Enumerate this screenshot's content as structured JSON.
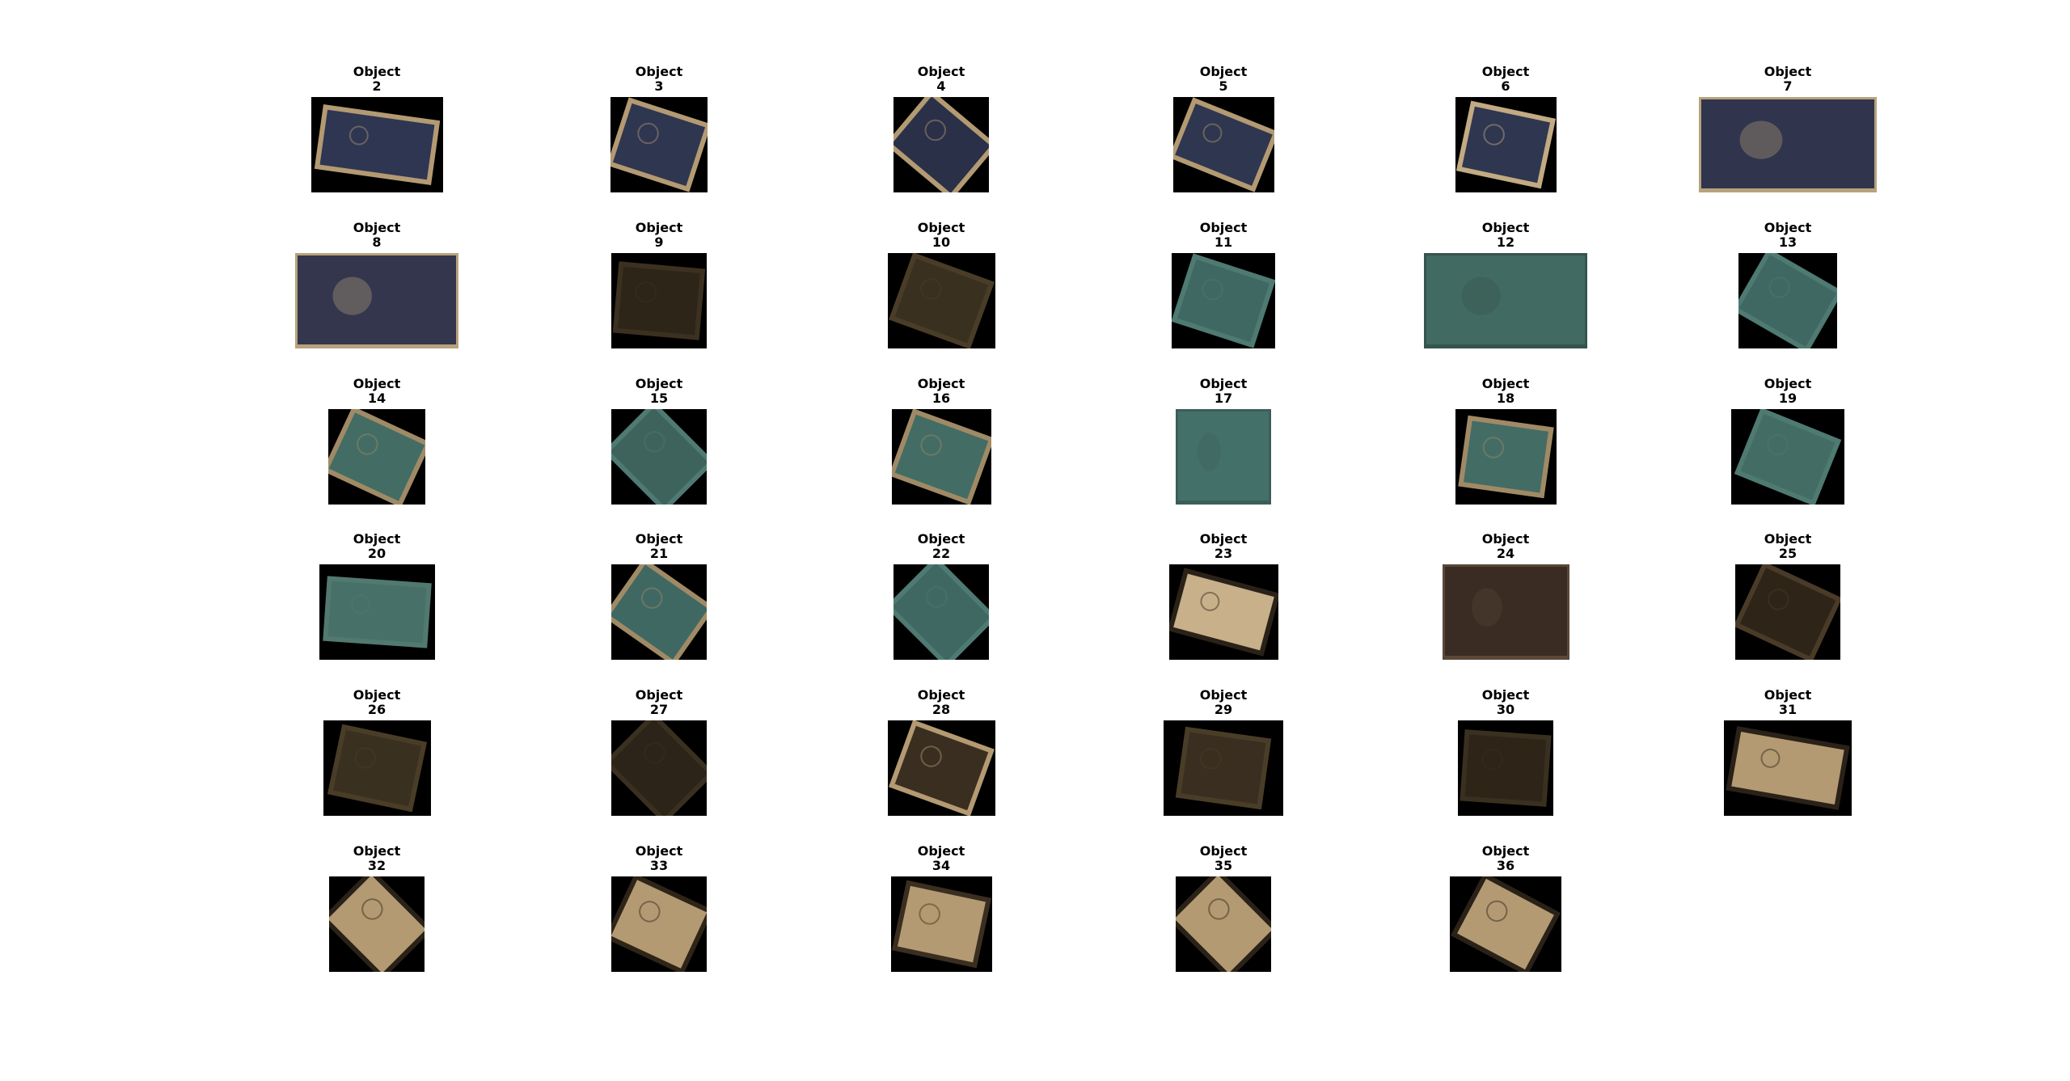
{
  "figure": {
    "objects": [
      {
        "title_line1": "Object",
        "title_line2": "2",
        "color": "#2e3652",
        "shade": "#b39a72",
        "shape": "wide",
        "angle": 8
      },
      {
        "title_line1": "Object",
        "title_line2": "3",
        "color": "#2f3650",
        "shade": "#b39a72",
        "shape": "square",
        "angle": 18
      },
      {
        "title_line1": "Object",
        "title_line2": "4",
        "color": "#2a3048",
        "shade": "#b39a72",
        "shape": "square",
        "angle": 40
      },
      {
        "title_line1": "Object",
        "title_line2": "5",
        "color": "#2f3650",
        "shade": "#b39a72",
        "shape": "wide",
        "angle": 22
      },
      {
        "title_line1": "Object",
        "title_line2": "6",
        "color": "#2f3650",
        "shade": "#c2aa82",
        "shape": "square",
        "angle": 12
      },
      {
        "title_line1": "Object",
        "title_line2": "7",
        "color": "#30354d",
        "shade": "#b8a27c",
        "shape": "fill",
        "angle": 0
      },
      {
        "title_line1": "Object",
        "title_line2": "8",
        "color": "#33364d",
        "shade": "#b8a27c",
        "shape": "fill",
        "angle": 2
      },
      {
        "title_line1": "Object",
        "title_line2": "9",
        "color": "#2d2518",
        "shade": "#3c3020",
        "shape": "square",
        "angle": 5
      },
      {
        "title_line1": "Object",
        "title_line2": "10",
        "color": "#3a3020",
        "shade": "#4a3d28",
        "shape": "square",
        "angle": 20
      },
      {
        "title_line1": "Object",
        "title_line2": "11",
        "color": "#3f6862",
        "shade": "#4e7a72",
        "shape": "square",
        "angle": 18
      },
      {
        "title_line1": "Object",
        "title_line2": "12",
        "color": "#416a62",
        "shade": "#36544e",
        "shape": "fill",
        "angle": 0
      },
      {
        "title_line1": "Object",
        "title_line2": "13",
        "color": "#3f6862",
        "shade": "#4e7a72",
        "shape": "square",
        "angle": 30
      },
      {
        "title_line1": "Object",
        "title_line2": "14",
        "color": "#436c64",
        "shade": "#a08a66",
        "shape": "square",
        "angle": 25
      },
      {
        "title_line1": "Object",
        "title_line2": "15",
        "color": "#3d635c",
        "shade": "#4e7a72",
        "shape": "square",
        "angle": 45
      },
      {
        "title_line1": "Object",
        "title_line2": "16",
        "color": "#436c64",
        "shade": "#a08a66",
        "shape": "square",
        "angle": 20
      },
      {
        "title_line1": "Object",
        "title_line2": "17",
        "color": "#44706a",
        "shade": "#3c5e58",
        "shape": "fill",
        "angle": 0
      },
      {
        "title_line1": "Object",
        "title_line2": "18",
        "color": "#436c64",
        "shade": "#a08a66",
        "shape": "square",
        "angle": 8
      },
      {
        "title_line1": "Object",
        "title_line2": "19",
        "color": "#436c64",
        "shade": "#4e7a72",
        "shape": "square",
        "angle": 22
      },
      {
        "title_line1": "Object",
        "title_line2": "20",
        "color": "#477068",
        "shade": "#52796f",
        "shape": "wide",
        "angle": 4
      },
      {
        "title_line1": "Object",
        "title_line2": "21",
        "color": "#3f6862",
        "shade": "#a08a66",
        "shape": "square",
        "angle": 35
      },
      {
        "title_line1": "Object",
        "title_line2": "22",
        "color": "#3f6862",
        "shade": "#4e7a72",
        "shape": "square",
        "angle": 45
      },
      {
        "title_line1": "Object",
        "title_line2": "23",
        "color": "#c8b08a",
        "shade": "#2a2218",
        "shape": "wide",
        "angle": 15
      },
      {
        "title_line1": "Object",
        "title_line2": "24",
        "color": "#3a2c22",
        "shade": "#5a4838",
        "shape": "fill",
        "angle": 0
      },
      {
        "title_line1": "Object",
        "title_line2": "25",
        "color": "#2e2418",
        "shade": "#4a3b28",
        "shape": "square",
        "angle": 25
      },
      {
        "title_line1": "Object",
        "title_line2": "26",
        "color": "#3a3020",
        "shade": "#4a3d28",
        "shape": "square",
        "angle": 12
      },
      {
        "title_line1": "Object",
        "title_line2": "27",
        "color": "#2c2418",
        "shade": "#3a3020",
        "shape": "square",
        "angle": 45
      },
      {
        "title_line1": "Object",
        "title_line2": "28",
        "color": "#3a2e20",
        "shade": "#b39a72",
        "shape": "square",
        "angle": 20
      },
      {
        "title_line1": "Object",
        "title_line2": "29",
        "color": "#3a2e20",
        "shade": "#4a3d28",
        "shape": "square",
        "angle": 8
      },
      {
        "title_line1": "Object",
        "title_line2": "30",
        "color": "#2e2418",
        "shade": "#3a3020",
        "shape": "square",
        "angle": 4
      },
      {
        "title_line1": "Object",
        "title_line2": "31",
        "color": "#b39a72",
        "shade": "#2a2218",
        "shape": "wide",
        "angle": 10
      },
      {
        "title_line1": "Object",
        "title_line2": "32",
        "color": "#b39a72",
        "shade": "#2a2218",
        "shape": "square",
        "angle": 45
      },
      {
        "title_line1": "Object",
        "title_line2": "33",
        "color": "#b39a72",
        "shade": "#2e2418",
        "shape": "square",
        "angle": 25
      },
      {
        "title_line1": "Object",
        "title_line2": "34",
        "color": "#b39a72",
        "shade": "#3a2e20",
        "shape": "square",
        "angle": 12
      },
      {
        "title_line1": "Object",
        "title_line2": "35",
        "color": "#b39a72",
        "shade": "#2a2218",
        "shape": "square",
        "angle": 45
      },
      {
        "title_line1": "Object",
        "title_line2": "36",
        "color": "#b39a72",
        "shade": "#2a2218",
        "shape": "square",
        "angle": 28
      }
    ]
  }
}
